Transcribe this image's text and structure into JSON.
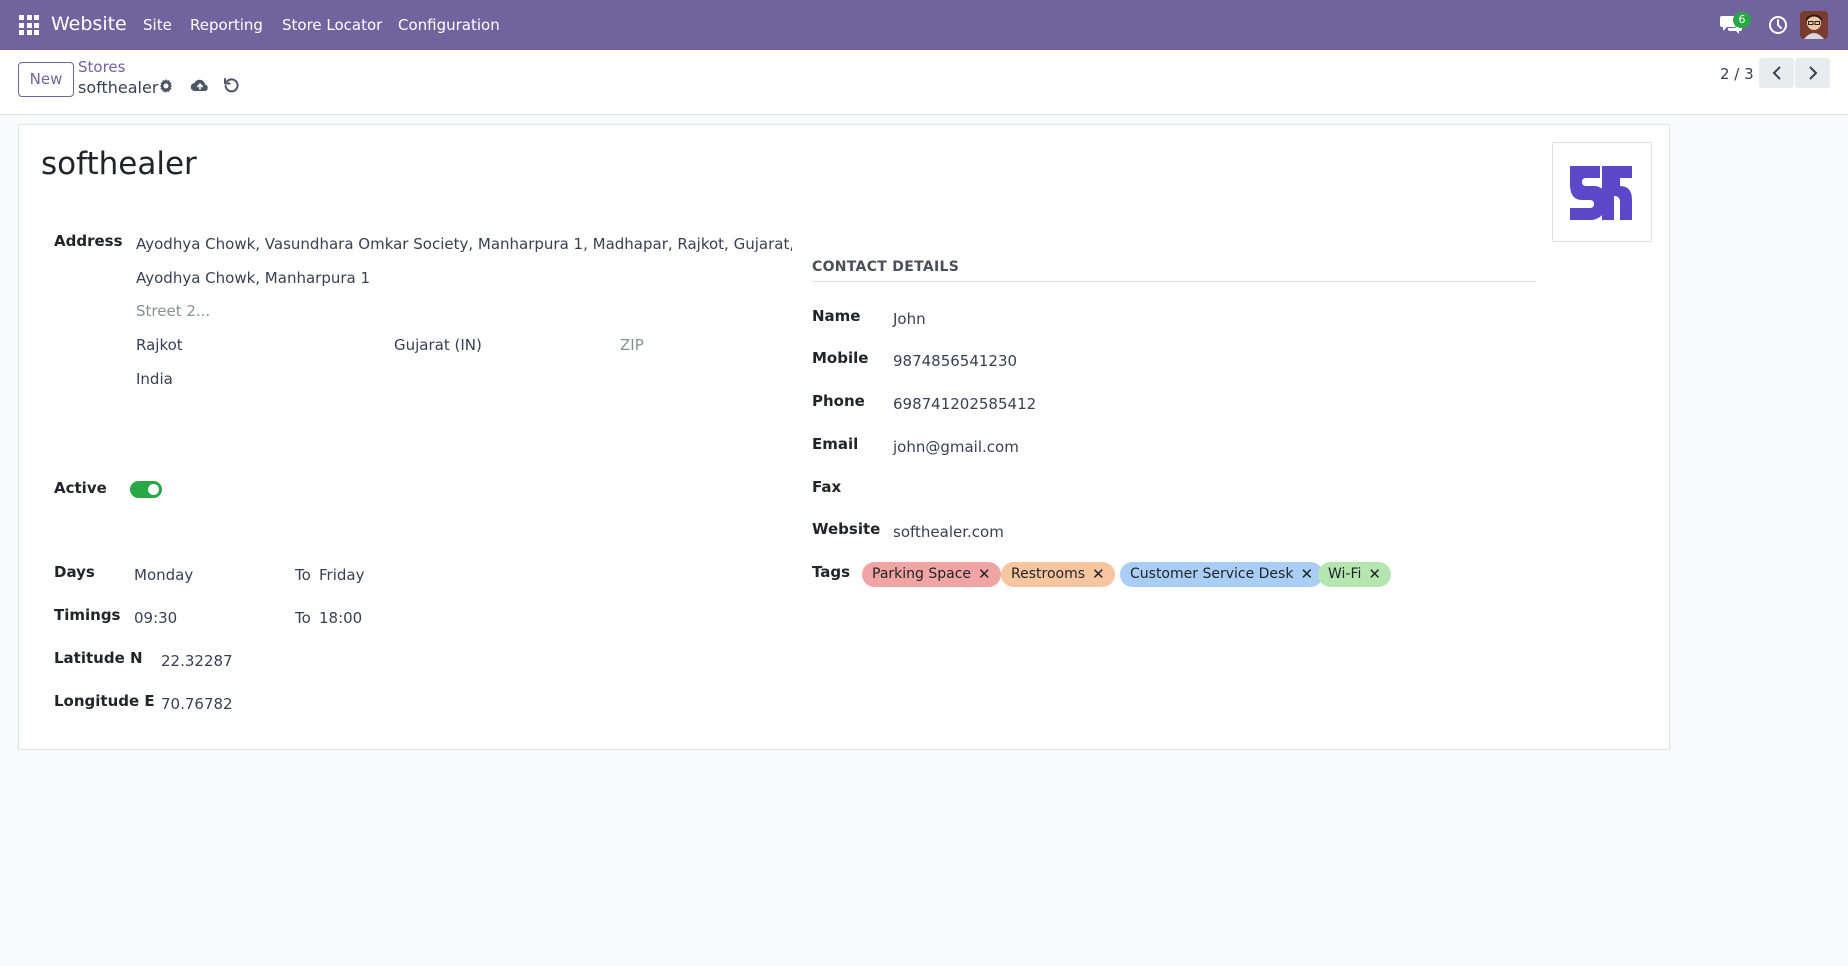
{
  "navbar": {
    "brand": "Website",
    "menu": [
      "Site",
      "Reporting",
      "Store Locator",
      "Configuration"
    ],
    "chat_count": "6",
    "icons": [
      "apps-icon",
      "chat-icon",
      "clock-icon",
      "avatar"
    ]
  },
  "control_panel": {
    "new_label": "New",
    "breadcrumb_parent": "Stores",
    "breadcrumb_current": "softhealer",
    "pager": "2 / 3"
  },
  "record": {
    "title": "softhealer",
    "address_label": "Address",
    "address_full": "Ayodhya Chowk, Vasundhara Omkar Society, Manharpura 1, Madhapar, Rajkot, Gujarat, India",
    "street": "Ayodhya Chowk,  Manharpura 1",
    "street2_placeholder": "Street 2...",
    "city": "Rajkot",
    "state": "Gujarat (IN)",
    "zip_placeholder": "ZIP",
    "country": "India",
    "active_label": "Active",
    "active": true,
    "days_label": "Days",
    "day_from": "Monday",
    "to_label": "To",
    "day_to": "Friday",
    "timings_label": "Timings",
    "time_from": "09:30",
    "time_to": "18:00",
    "latitude_label": "Latitude N",
    "latitude": "22.32287",
    "longitude_label": "Longitude E",
    "longitude": "70.76782"
  },
  "contact": {
    "heading": "CONTACT DETAILS",
    "name_label": "Name",
    "name": "John",
    "mobile_label": "Mobile",
    "mobile": "9874856541230",
    "phone_label": "Phone",
    "phone": "698741202585412",
    "email_label": "Email",
    "email": "john@gmail.com",
    "fax_label": "Fax",
    "fax": "",
    "website_label": "Website",
    "website": "softhealer.com",
    "tags_label": "Tags",
    "tags": [
      {
        "label": "Parking Space",
        "color": "#f0a4a4"
      },
      {
        "label": "Restrooms",
        "color": "#f7c59f"
      },
      {
        "label": "Customer Service Desk",
        "color": "#a9cdf4"
      },
      {
        "label": "Wi-Fi",
        "color": "#b5e6b0"
      }
    ]
  },
  "colors": {
    "navbar": "#71639e",
    "accent": "#71639e",
    "toggle_on": "#28a745",
    "logo": "#5b47c8"
  }
}
